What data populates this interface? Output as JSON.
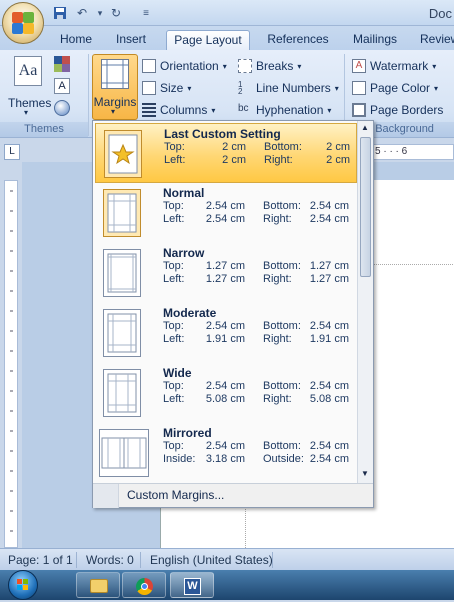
{
  "window": {
    "title": "Doc"
  },
  "tabs": [
    {
      "label": "Home"
    },
    {
      "label": "Insert"
    },
    {
      "label": "Page Layout"
    },
    {
      "label": "References"
    },
    {
      "label": "Mailings"
    },
    {
      "label": "Review"
    }
  ],
  "ribbon": {
    "themes_label": "Themes",
    "themes_group": "Themes",
    "margins_label": "Margins",
    "orientation": "Orientation",
    "size": "Size",
    "columns": "Columns",
    "breaks": "Breaks",
    "line_numbers": "Line Numbers",
    "hyphenation": "Hyphenation",
    "watermark": "Watermark",
    "page_color": "Page Color",
    "page_borders": "Page Borders",
    "page_background_group": "e Background"
  },
  "ruler": {
    "tab_marker": "L",
    "h_labels": "5 · · · 6"
  },
  "margins_menu": {
    "options": [
      {
        "name": "Last Custom Setting",
        "k1": "Top:",
        "v1": "2 cm",
        "k2": "Bottom:",
        "v2": "2 cm",
        "k3": "Left:",
        "v3": "2 cm",
        "k4": "Right:",
        "v4": "2 cm"
      },
      {
        "name": "Normal",
        "k1": "Top:",
        "v1": "2.54 cm",
        "k2": "Bottom:",
        "v2": "2.54 cm",
        "k3": "Left:",
        "v3": "2.54 cm",
        "k4": "Right:",
        "v4": "2.54 cm"
      },
      {
        "name": "Narrow",
        "k1": "Top:",
        "v1": "1.27 cm",
        "k2": "Bottom:",
        "v2": "1.27 cm",
        "k3": "Left:",
        "v3": "1.27 cm",
        "k4": "Right:",
        "v4": "1.27 cm"
      },
      {
        "name": "Moderate",
        "k1": "Top:",
        "v1": "2.54 cm",
        "k2": "Bottom:",
        "v2": "2.54 cm",
        "k3": "Left:",
        "v3": "1.91 cm",
        "k4": "Right:",
        "v4": "1.91 cm"
      },
      {
        "name": "Wide",
        "k1": "Top:",
        "v1": "2.54 cm",
        "k2": "Bottom:",
        "v2": "2.54 cm",
        "k3": "Left:",
        "v3": "5.08 cm",
        "k4": "Right:",
        "v4": "5.08 cm"
      },
      {
        "name": "Mirrored",
        "k1": "Top:",
        "v1": "2.54 cm",
        "k2": "Bottom:",
        "v2": "2.54 cm",
        "k3": "Inside:",
        "v3": "3.18 cm",
        "k4": "Outside:",
        "v4": "2.54 cm"
      }
    ],
    "custom_margins": "Custom Margins..."
  },
  "status": {
    "page": "Page: 1 of 1",
    "words": "Words: 0",
    "language": "English (United States)"
  },
  "icons": {
    "office": "office-button-icon",
    "start": "windows-start-icon"
  }
}
